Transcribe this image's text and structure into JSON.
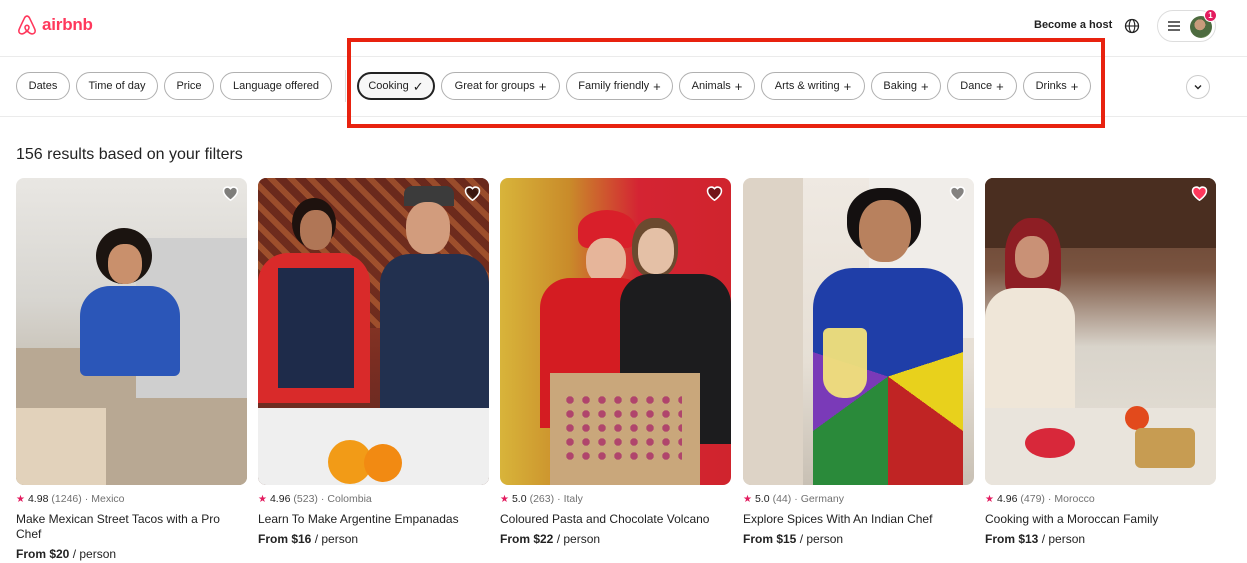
{
  "header": {
    "logo_text": "airbnb",
    "become_host": "Become a host",
    "notification_count": "1"
  },
  "filters": [
    {
      "label": "Dates",
      "selected": false,
      "has_plus": false
    },
    {
      "label": "Time of day",
      "selected": false,
      "has_plus": false
    },
    {
      "label": "Price",
      "selected": false,
      "has_plus": false
    },
    {
      "label": "Language offered",
      "selected": false,
      "has_plus": false
    },
    {
      "label": "Cooking",
      "selected": true,
      "has_plus": false
    },
    {
      "label": "Great for groups",
      "selected": false,
      "has_plus": true
    },
    {
      "label": "Family friendly",
      "selected": false,
      "has_plus": true
    },
    {
      "label": "Animals",
      "selected": false,
      "has_plus": true
    },
    {
      "label": "Arts & writing",
      "selected": false,
      "has_plus": true
    },
    {
      "label": "Baking",
      "selected": false,
      "has_plus": true
    },
    {
      "label": "Dance",
      "selected": false,
      "has_plus": true
    },
    {
      "label": "Drinks",
      "selected": false,
      "has_plus": true
    }
  ],
  "results_title": "156 results based on your filters",
  "listings": [
    {
      "rating": "4.98",
      "reviews": "(1246)",
      "location": "Mexico",
      "title": "Make Mexican Street Tacos with a Pro Chef",
      "price": "From $20",
      "per": "/ person",
      "favorited": false
    },
    {
      "rating": "4.96",
      "reviews": "(523)",
      "location": "Colombia",
      "title": "Learn To Make Argentine Empanadas",
      "price": "From $16",
      "per": "/ person",
      "favorited": false
    },
    {
      "rating": "5.0",
      "reviews": "(263)",
      "location": "Italy",
      "title": "Coloured Pasta and Chocolate Volcano",
      "price": "From $22",
      "per": "/ person",
      "favorited": false
    },
    {
      "rating": "5.0",
      "reviews": "(44)",
      "location": "Germany",
      "title": "Explore Spices With An Indian Chef",
      "price": "From $15",
      "per": "/ person",
      "favorited": false
    },
    {
      "rating": "4.96",
      "reviews": "(479)",
      "location": "Morocco",
      "title": "Cooking with a Moroccan Family",
      "price": "From $13",
      "per": "/ person",
      "favorited": true
    }
  ],
  "colors": {
    "brand": "#FF385C",
    "highlight": "#E8220F",
    "star": "#E31C5F"
  }
}
